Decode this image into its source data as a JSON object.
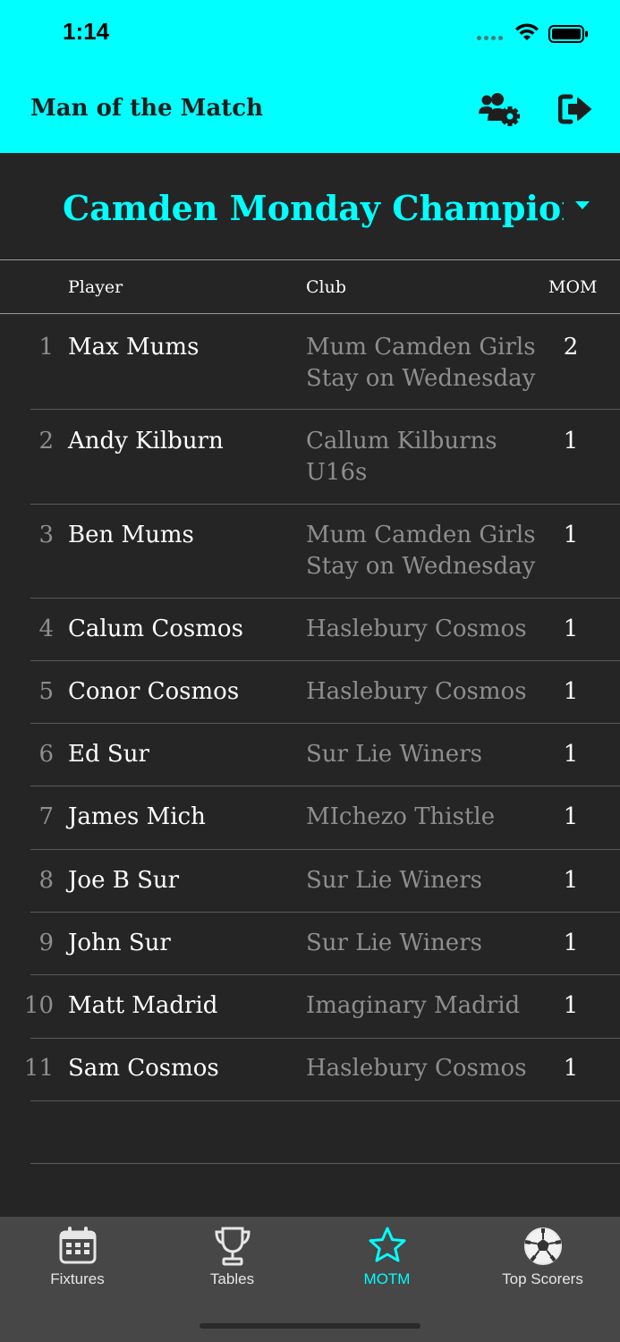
{
  "status_bar": {
    "time": "1:14"
  },
  "header": {
    "title": "Man of the Match",
    "manage_icon": "users-gear-icon",
    "logout_icon": "sign-out-icon"
  },
  "league": {
    "selected": "Camden Monday Champions..."
  },
  "table": {
    "columns": {
      "player": "Player",
      "club": "Club",
      "mom": "MOM"
    },
    "rows": [
      {
        "rank": "1",
        "player": "Max Mums",
        "club": "Mum Camden Girls Stay on Wednesday",
        "mom": "2"
      },
      {
        "rank": "2",
        "player": "Andy Kilburn",
        "club": "Callum Kilburns U16s",
        "mom": "1"
      },
      {
        "rank": "3",
        "player": "Ben Mums",
        "club": "Mum Camden Girls Stay on Wednesday",
        "mom": "1"
      },
      {
        "rank": "4",
        "player": "Calum Cosmos",
        "club": "Haslebury Cosmos",
        "mom": "1"
      },
      {
        "rank": "5",
        "player": "Conor Cosmos",
        "club": "Haslebury Cosmos",
        "mom": "1"
      },
      {
        "rank": "6",
        "player": "Ed Sur",
        "club": "Sur Lie Winers",
        "mom": "1"
      },
      {
        "rank": "7",
        "player": "James Mich",
        "club": "MIchezo Thistle",
        "mom": "1"
      },
      {
        "rank": "8",
        "player": "Joe B Sur",
        "club": "Sur Lie Winers",
        "mom": "1"
      },
      {
        "rank": "9",
        "player": "John Sur",
        "club": "Sur Lie Winers",
        "mom": "1"
      },
      {
        "rank": "10",
        "player": "Matt Madrid",
        "club": "Imaginary Madrid",
        "mom": "1"
      },
      {
        "rank": "11",
        "player": "Sam Cosmos",
        "club": "Haslebury Cosmos",
        "mom": "1"
      }
    ]
  },
  "tabs": [
    {
      "label": "Fixtures",
      "icon": "calendar-icon",
      "active": false
    },
    {
      "label": "Tables",
      "icon": "trophy-icon",
      "active": false
    },
    {
      "label": "MOTM",
      "icon": "star-icon",
      "active": true
    },
    {
      "label": "Top Scorers",
      "icon": "soccer-ball-icon",
      "active": false
    }
  ],
  "colors": {
    "accent": "#00FFFF",
    "background": "#252525",
    "tabbar": "#474747",
    "muted_text": "#8e8e8e"
  }
}
